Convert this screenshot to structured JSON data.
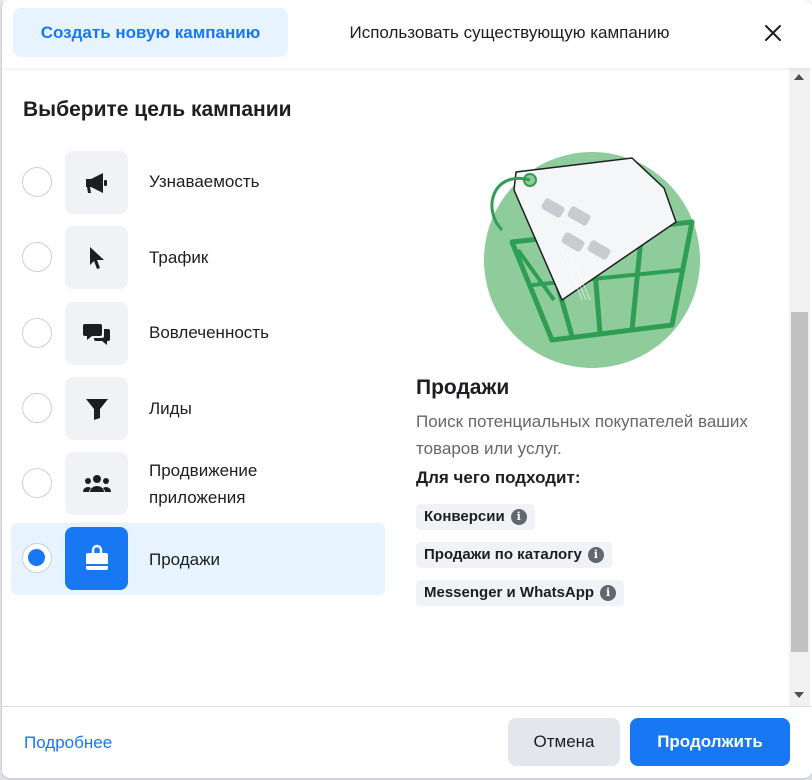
{
  "header": {
    "tab_new": "Создать новую кампанию",
    "tab_existing": "Использовать существующую кампанию"
  },
  "main": {
    "title": "Выберите цель кампании",
    "objectives": [
      {
        "label": "Узнаваемость",
        "icon": "megaphone-icon",
        "selected": false
      },
      {
        "label": "Трафик",
        "icon": "cursor-icon",
        "selected": false
      },
      {
        "label": "Вовлеченность",
        "icon": "chat-bubbles-icon",
        "selected": false
      },
      {
        "label": "Лиды",
        "icon": "filter-icon",
        "selected": false
      },
      {
        "label": "Продвижение приложения",
        "icon": "people-icon",
        "selected": false
      },
      {
        "label": "Продажи",
        "icon": "shopping-bag-icon",
        "selected": true
      }
    ]
  },
  "detail": {
    "title": "Продажи",
    "description": "Поиск потенциальных покупателей ваших товаров или услуг.",
    "subtitle": "Для чего подходит:",
    "chips": [
      "Конверсии",
      "Продажи по каталогу",
      "Messenger и WhatsApp"
    ]
  },
  "footer": {
    "learn_more": "Подробнее",
    "cancel": "Отмена",
    "continue": "Продолжить"
  },
  "colors": {
    "accent": "#1877f2",
    "accent_light": "#e7f3ff",
    "illustration_green": "#8fcc9c"
  }
}
